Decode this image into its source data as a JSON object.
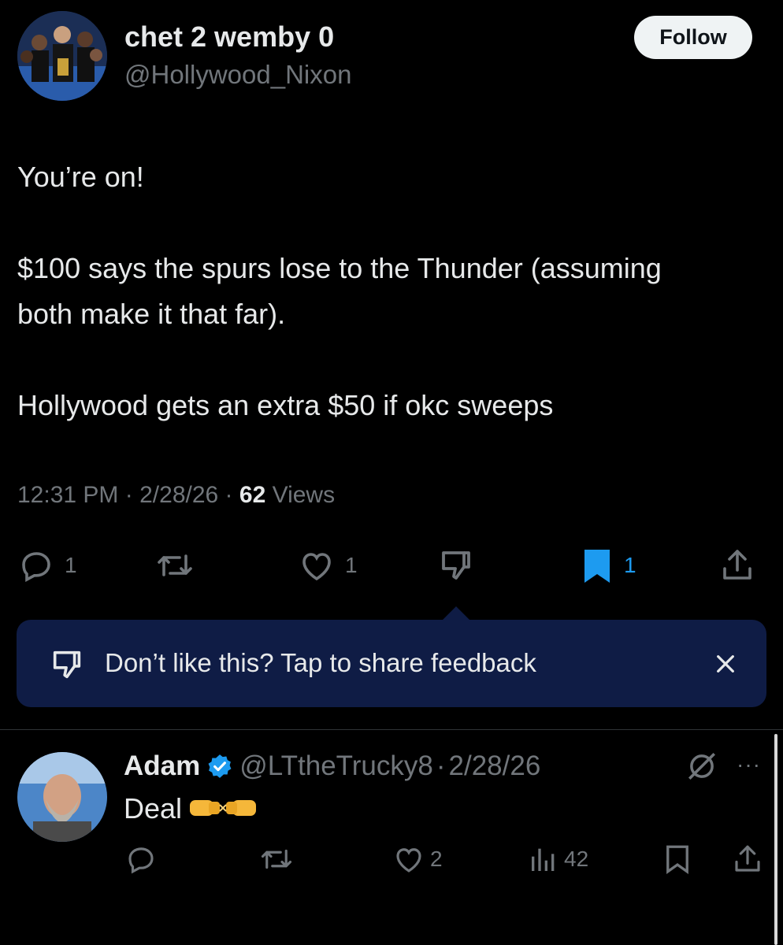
{
  "tweet": {
    "author": {
      "display_name": "chet 2 wemby 0",
      "handle": "@Hollywood_Nixon"
    },
    "follow_label": "Follow",
    "paragraphs": [
      "You’re on!",
      "$100 says the spurs lose to the Thunder (assuming both make it that far).",
      "Hollywood gets an extra $50 if okc sweeps"
    ],
    "time": "12:31 PM",
    "date": "2/28/26",
    "sep": "·",
    "views_count": "62",
    "views_label": "Views",
    "actions": {
      "reply_count": "1",
      "like_count": "1",
      "bookmark_count": "1"
    },
    "accent": "#1d9bf0"
  },
  "feedback": {
    "text": "Don’t like this? Tap to share feedback",
    "bg": "#0f1c45"
  },
  "reply": {
    "author": {
      "display_name": "Adam",
      "handle": "@LTtheTrucky8",
      "verified": true
    },
    "sep": "·",
    "date": "2/28/26",
    "text": "Deal",
    "emoji": "🤜🤛",
    "actions": {
      "like_count": "2",
      "views_count": "42"
    }
  }
}
